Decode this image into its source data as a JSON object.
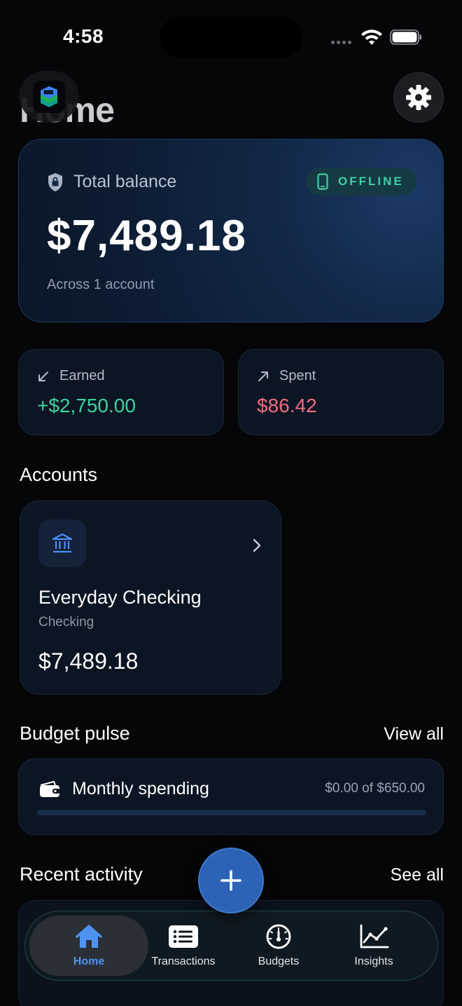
{
  "status_bar": {
    "time": "4:58"
  },
  "header": {
    "title": "Home"
  },
  "balance_card": {
    "label": "Total balance",
    "badge": "OFFLINE",
    "amount": "$7,489.18",
    "subtitle": "Across 1 account"
  },
  "stats": {
    "earned": {
      "label": "Earned",
      "value": "+$2,750.00"
    },
    "spent": {
      "label": "Spent",
      "value": "$86.42"
    }
  },
  "accounts": {
    "heading": "Accounts",
    "items": [
      {
        "name": "Everyday Checking",
        "type": "Checking",
        "balance": "$7,489.18"
      }
    ]
  },
  "budget": {
    "heading": "Budget pulse",
    "link": "View all",
    "items": [
      {
        "name": "Monthly spending",
        "amount": "$0.00 of $650.00",
        "progress": 0
      }
    ]
  },
  "recent": {
    "heading": "Recent activity",
    "link": "See all"
  },
  "tabs": [
    {
      "label": "Home",
      "icon": "home-icon"
    },
    {
      "label": "Transactions",
      "icon": "list-icon"
    },
    {
      "label": "Budgets",
      "icon": "gauge-icon"
    },
    {
      "label": "Insights",
      "icon": "chart-icon"
    }
  ],
  "colors": {
    "accent": "#4f93f0",
    "earned": "#3ed39a",
    "spent": "#f26d7f",
    "offline": "#3fd0a4"
  }
}
